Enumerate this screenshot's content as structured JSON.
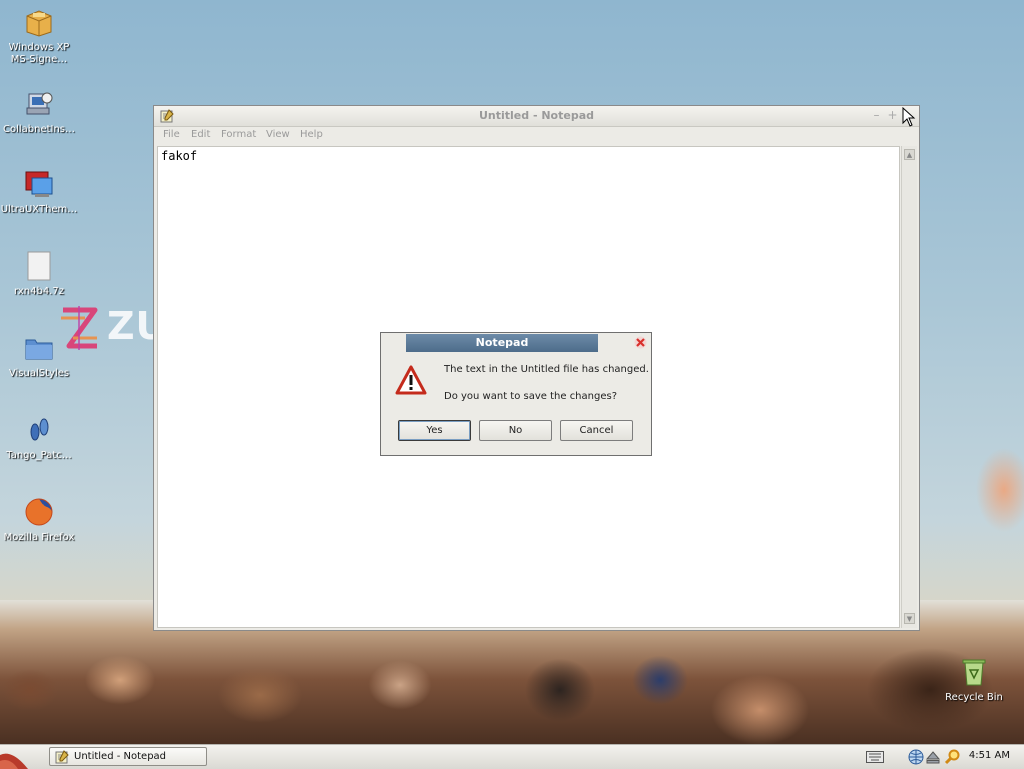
{
  "desktop": {
    "icons": [
      {
        "label": "Windows XP MS-Signe…",
        "icon": "package-icon"
      },
      {
        "label": "CollabnetIns…",
        "icon": "installer-icon"
      },
      {
        "label": "UltraUXThem…",
        "icon": "theme-icon"
      },
      {
        "label": "rxn4b4.7z",
        "icon": "file-icon"
      },
      {
        "label": "VisualStyles",
        "icon": "folder-icon"
      },
      {
        "label": "Tango_Patc…",
        "icon": "footprints-icon"
      },
      {
        "label": "Mozilla Firefox",
        "icon": "firefox-icon"
      }
    ],
    "recycle_bin": {
      "label": "Recycle Bin",
      "icon": "recycle-bin-icon"
    },
    "wallpaper_logo_text": "ZU"
  },
  "notepad": {
    "title": "Untitled - Notepad",
    "menu": [
      "File",
      "Edit",
      "Format",
      "View",
      "Help"
    ],
    "content": "fakof"
  },
  "dialog": {
    "title": "Notepad",
    "message": "The text in the Untitled file has changed.",
    "question": "Do you want to save the changes?",
    "buttons": {
      "yes": "Yes",
      "no": "No",
      "cancel": "Cancel"
    }
  },
  "taskbar": {
    "task_label": "Untitled - Notepad",
    "clock": "4:51 AM"
  },
  "colors": {
    "dialog_title": "#5a7896",
    "close_red": "#d9302c"
  }
}
